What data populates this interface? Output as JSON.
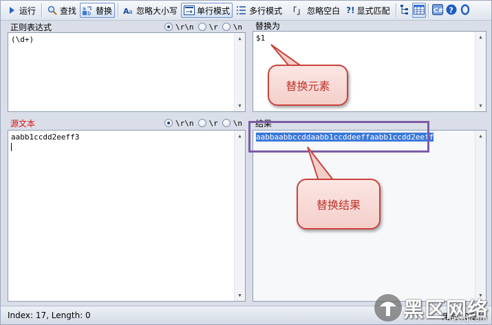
{
  "toolbar": {
    "run": "运行",
    "find": "查找",
    "replace": "替换",
    "ignore_case": "忽略大小写",
    "single_line": "单行模式",
    "multi_line": "多行模式",
    "ignore_space_glyph": "「」",
    "ignore_space": "忽略空白",
    "explicit_glyph": "?!",
    "explicit": "显式匹配"
  },
  "regex_panel": {
    "title": "正则表达式",
    "options": [
      "\\r\\n",
      "\\r",
      "\\n"
    ],
    "selected": 0,
    "value": "(\\d+)"
  },
  "replace_panel": {
    "title": "替换为",
    "value": "$1"
  },
  "source_panel": {
    "title": "源文本",
    "options": [
      "\\r\\n",
      "\\r",
      "\\n"
    ],
    "selected": 0,
    "value": "aabb1ccdd2eeff3"
  },
  "result_panel": {
    "title": "结果",
    "value": "aabbaabbccddaabb1ccddeeffaabb1ccdd2eeff"
  },
  "status": {
    "left": "Index: 17, Length: 0",
    "right": "用时: 0毫秒"
  },
  "callouts": {
    "replace_element": "替换元素",
    "replace_result": "替换结果"
  },
  "colors": {
    "callout_border": "#c9423c",
    "callout_text": "#c0322b",
    "highlight_box": "#7b5aa6",
    "selection": "#3a78d8",
    "title_red": "#dd1111"
  },
  "watermark": {
    "text": "黑区网络",
    "sub": "he.rq.com"
  }
}
